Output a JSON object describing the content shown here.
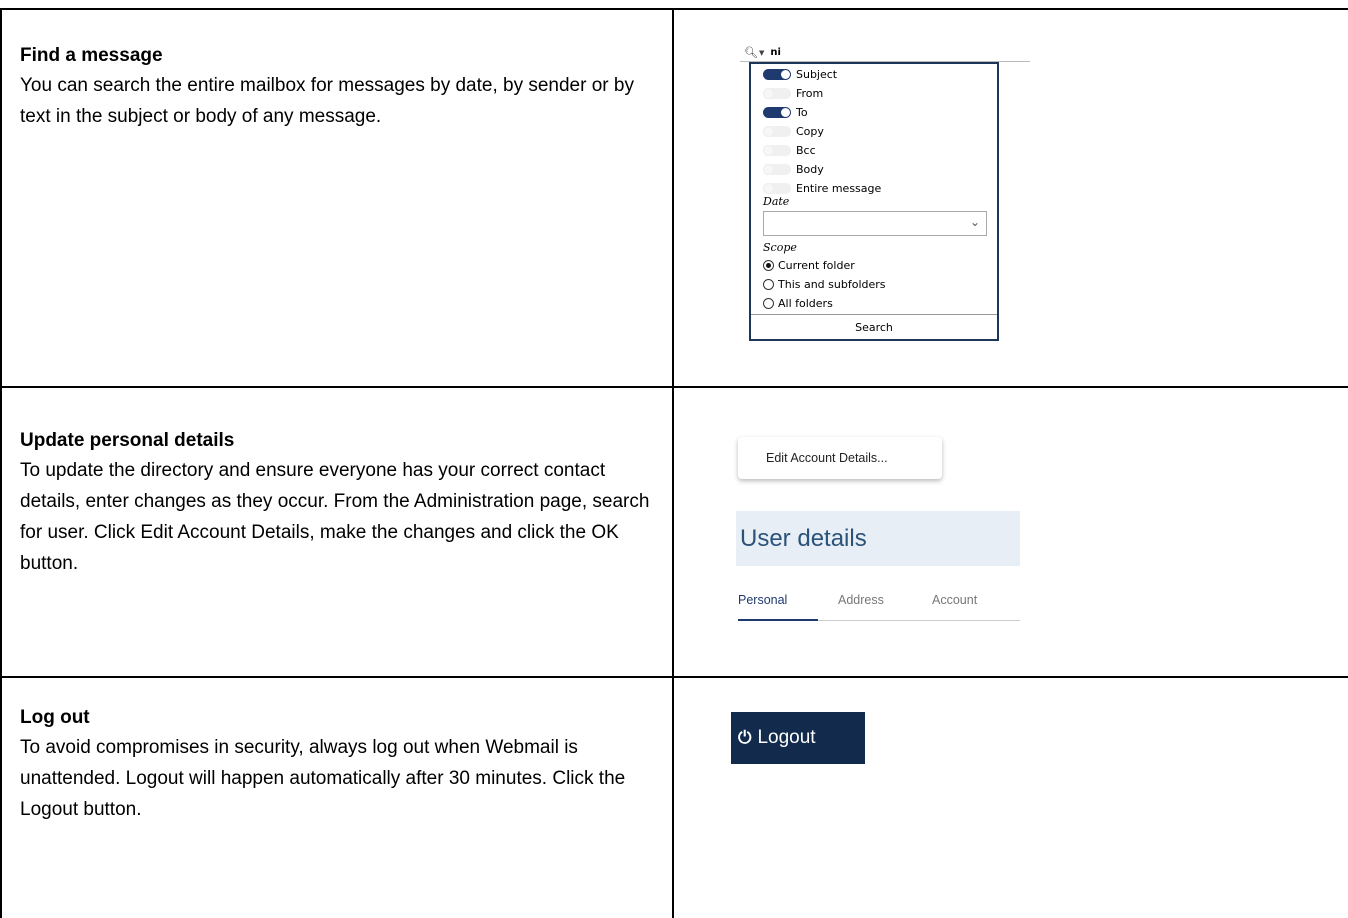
{
  "sections": [
    {
      "heading": "Find a message",
      "body": "You can search the entire mailbox for messages by date, by sender or by text in the subject or body of any message."
    },
    {
      "heading": "Update personal details",
      "body": "To update the directory and ensure everyone has your correct contact details, enter changes as they occur. From the Administration page, search for user. Click Edit Account Details, make the changes and click the OK button."
    },
    {
      "heading": "Log out",
      "body": "To avoid compromises in security, always log out when Webmail is unattended. Logout will happen automatically after 30 minutes. Click the Logout button."
    }
  ],
  "search_popup": {
    "query": "ni",
    "toggles": [
      {
        "label": "Subject",
        "on": true
      },
      {
        "label": "From",
        "on": false
      },
      {
        "label": "To",
        "on": true
      },
      {
        "label": "Copy",
        "on": false
      },
      {
        "label": "Bcc",
        "on": false
      },
      {
        "label": "Body",
        "on": false
      },
      {
        "label": "Entire message",
        "on": false
      }
    ],
    "date_label": "Date",
    "date_value": "",
    "scope_label": "Scope",
    "scope_options": [
      {
        "label": "Current folder",
        "checked": true
      },
      {
        "label": "This and subfolders",
        "checked": false
      },
      {
        "label": "All folders",
        "checked": false
      }
    ],
    "search_button": "Search"
  },
  "account": {
    "edit_button": "Edit Account Details...",
    "header": "User details",
    "tabs": [
      "Personal",
      "Address",
      "Account"
    ],
    "active_tab": "Personal"
  },
  "logout": {
    "label": "Logout",
    "icon": "power-icon"
  },
  "colors": {
    "navy": "#122b4d",
    "accent": "#1e3a6e",
    "header_bg": "#e8eef5",
    "header_text": "#2b5279"
  }
}
